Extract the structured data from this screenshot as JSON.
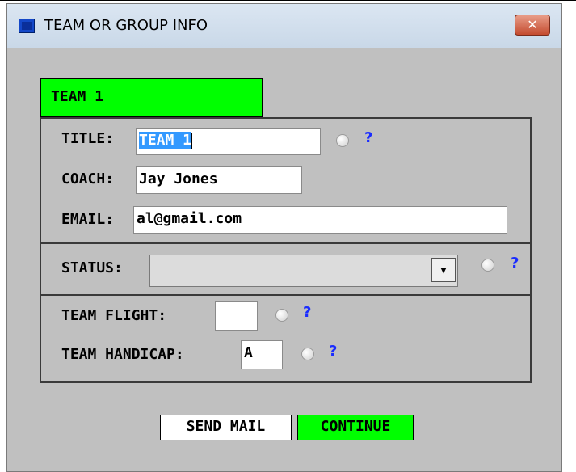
{
  "window": {
    "title": "TEAM OR GROUP INFO",
    "close_glyph": "✕"
  },
  "tab": {
    "label": "TEAM 1"
  },
  "form": {
    "title_label": "TITLE:",
    "title_value": "TEAM 1",
    "coach_label": "COACH:",
    "coach_value": "Jay Jones",
    "email_label": "EMAIL:",
    "email_value": "al@gmail.com",
    "status_label": "STATUS:",
    "status_value": "",
    "flight_label": "TEAM FLIGHT:",
    "flight_value": "",
    "handicap_label": "TEAM HANDICAP:",
    "handicap_value": "A",
    "help_glyph": "?",
    "dropdown_glyph": "▼"
  },
  "buttons": {
    "send_mail": "SEND MAIL",
    "continue": "CONTINUE"
  },
  "colors": {
    "accent_green": "#00ff00",
    "help_blue": "#1a2cff",
    "window_bg": "#c0c0c0",
    "selection": "#3399ff"
  },
  "icons": [
    "app-icon",
    "close-icon",
    "radio-icon",
    "help-icon",
    "dropdown-arrow-icon"
  ]
}
